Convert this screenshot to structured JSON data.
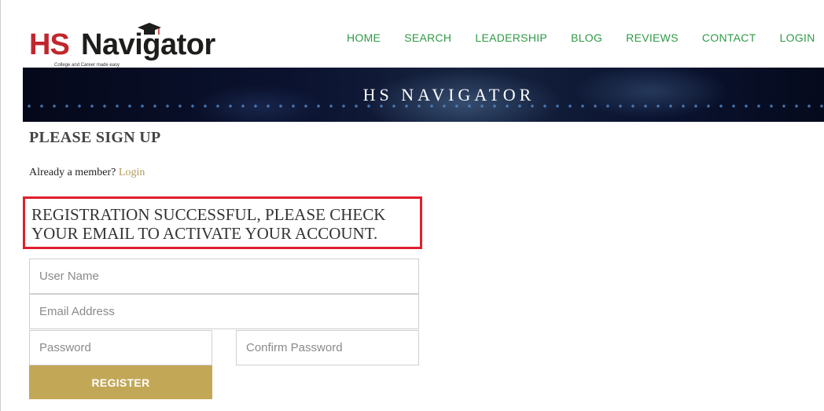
{
  "logo": {
    "part1": "HS",
    "part2": "Navigator",
    "tagline": "College and Career made easy"
  },
  "nav": [
    "HOME",
    "SEARCH",
    "LEADERSHIP",
    "BLOG",
    "REVIEWS",
    "CONTACT",
    "LOGIN"
  ],
  "banner": {
    "title": "HS NAVIGATOR"
  },
  "page": {
    "heading": "PLEASE SIGN UP",
    "member_prompt": "Already a member?",
    "login_link": "Login",
    "success_message": "REGISTRATION SUCCESSFUL, PLEASE CHECK YOUR EMAIL TO ACTIVATE YOUR ACCOUNT."
  },
  "form": {
    "username_placeholder": "User Name",
    "email_placeholder": "Email Address",
    "password_placeholder": "Password",
    "confirm_placeholder": "Confirm Password",
    "register_label": "REGISTER"
  },
  "colors": {
    "brand_red": "#c0272d",
    "nav_green": "#2f9a46",
    "gold_button": "#c2a757",
    "alert_border": "#e01f2c"
  }
}
